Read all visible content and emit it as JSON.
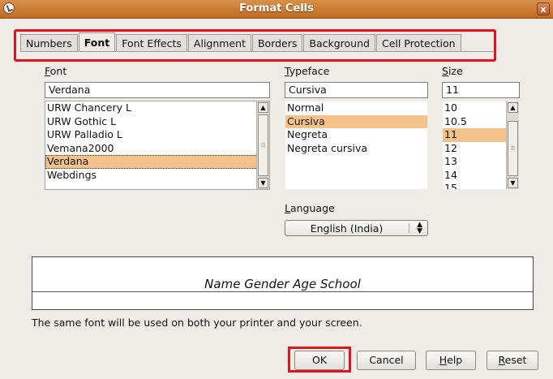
{
  "window": {
    "title": "Format Cells",
    "close_glyph": "x",
    "icon": "app-icon"
  },
  "tabs": [
    {
      "label": "Numbers",
      "active": false
    },
    {
      "label": "Font",
      "active": true
    },
    {
      "label": "Font Effects",
      "active": false
    },
    {
      "label": "Alignment",
      "active": false
    },
    {
      "label": "Borders",
      "active": false
    },
    {
      "label": "Background",
      "active": false
    },
    {
      "label": "Cell Protection",
      "active": false
    }
  ],
  "font": {
    "label_mnemonic": "F",
    "label_rest": "ont",
    "value": "Verdana",
    "items": [
      "URW Chancery L",
      "URW Gothic L",
      "URW Palladio L",
      "Vemana2000",
      "Verdana",
      "Webdings"
    ],
    "selected": "Verdana"
  },
  "typeface": {
    "label_mnemonic": "T",
    "label_rest": "ypeface",
    "value": "Cursiva",
    "items": [
      "Normal",
      "Cursiva",
      "Negreta",
      "Negreta cursiva"
    ],
    "selected": "Cursiva"
  },
  "size": {
    "label_mnemonic": "S",
    "label_rest": "ize",
    "value": "11",
    "items": [
      "10",
      "10.5",
      "11",
      "12",
      "13",
      "14",
      "15"
    ],
    "selected": "11"
  },
  "language": {
    "label_mnemonic": "L",
    "label_rest": "anguage",
    "value": "English (India)"
  },
  "preview": {
    "text": "Name Gender Age School"
  },
  "note": "The same font will be used on both your printer and your screen.",
  "buttons": {
    "ok": "OK",
    "cancel": "Cancel",
    "help_mnemonic": "H",
    "help_rest": "elp",
    "reset_mnemonic": "R",
    "reset_rest": "eset"
  },
  "colors": {
    "titlebar": "#c87430",
    "selection": "#f5c28c",
    "annotation_highlight": "#e0141e"
  }
}
